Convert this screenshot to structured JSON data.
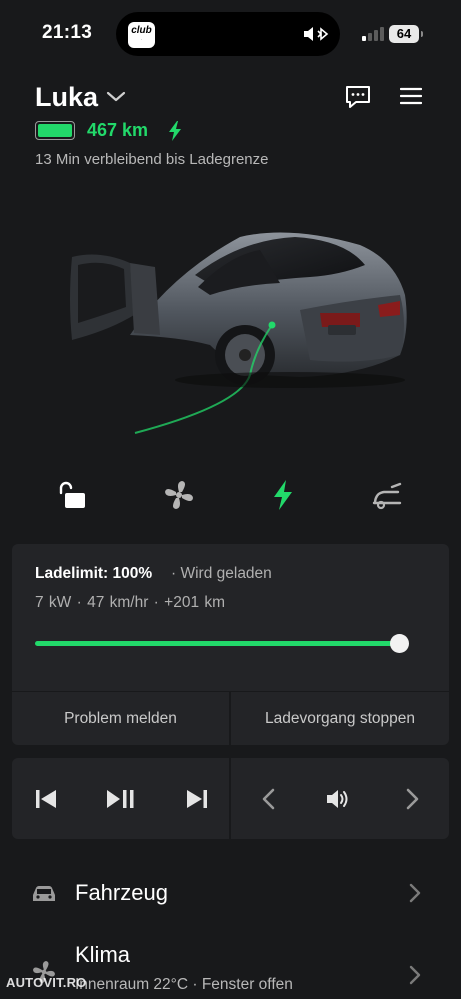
{
  "status_bar": {
    "time": "21:13",
    "app_badge": "club",
    "battery_level": "64"
  },
  "header": {
    "car_name": "Luka",
    "range": "467 km",
    "battery_fill_fraction": 1.0,
    "remaining_text": "13 Min verbleibend bis Ladegrenze"
  },
  "quick_controls": [
    {
      "icon": "unlock-icon"
    },
    {
      "icon": "fan-icon"
    },
    {
      "icon": "charging-bolt-icon"
    },
    {
      "icon": "frunk-icon"
    }
  ],
  "charging": {
    "limit_label": "Ladelimit: 100%",
    "status": "· Wird geladen",
    "stats": "7 kW · 47 km/hr · +201 km",
    "limit_fraction": 1.0,
    "report_button": "Problem melden",
    "stop_button": "Ladevorgang stoppen"
  },
  "media": {
    "controls": [
      "previous-track-icon",
      "play-pause-icon",
      "next-track-icon",
      "source-prev-icon",
      "volume-icon",
      "source-next-icon"
    ]
  },
  "menu": [
    {
      "title": "Fahrzeug",
      "subtitle": "",
      "icon": "car-icon"
    },
    {
      "title": "Klima",
      "subtitle": "Innenraum 22°C · Fenster offen",
      "icon": "fan-icon"
    }
  ],
  "watermark": "AUTOVIT.RO",
  "colors": {
    "background": "#18191b",
    "card": "#232427",
    "accent_green": "#22d96a",
    "secondary_text": "#b0b0b0"
  }
}
